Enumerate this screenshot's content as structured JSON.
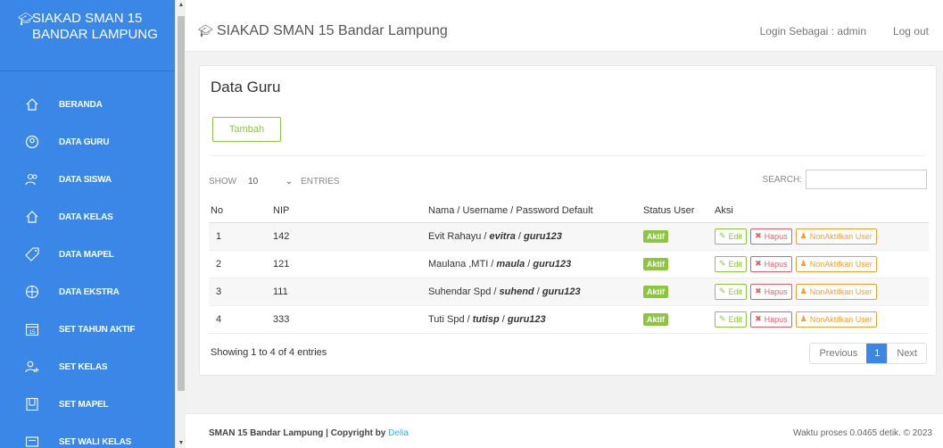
{
  "sidebar": {
    "brand_line1": "SIAKAD SMAN 15",
    "brand_line2": "BANDAR LAMPUNG",
    "brand_icon": "graduation-cap-icon",
    "items": [
      {
        "label": "BERANDA",
        "icon": "home-icon"
      },
      {
        "label": "DATA GURU",
        "icon": "user-circle-icon"
      },
      {
        "label": "DATA SISWA",
        "icon": "users-icon"
      },
      {
        "label": "DATA KELAS",
        "icon": "home-icon"
      },
      {
        "label": "DATA MAPEL",
        "icon": "tag-icon"
      },
      {
        "label": "DATA EKSTRA",
        "icon": "compass-icon"
      },
      {
        "label": "SET TAHUN AKTIF",
        "icon": "calendar-icon"
      },
      {
        "label": "SET KELAS",
        "icon": "user-plus-icon"
      },
      {
        "label": "SET MAPEL",
        "icon": "book-icon"
      },
      {
        "label": "SET WALI KELAS",
        "icon": "id-card-icon"
      }
    ],
    "calendar_number": "15"
  },
  "topbar": {
    "title": "SIAKAD SMAN 15 Bandar Lampung",
    "login_as": "Login Sebagai : admin",
    "logout": "Log out"
  },
  "main": {
    "heading": "Data Guru",
    "add_button": "Tambah",
    "show_label": "SHOW",
    "show_value": "10",
    "entries_label": "ENTRIES",
    "search_label": "SEARCH:",
    "columns": [
      "No",
      "NIP",
      "Nama / Username / Password Default",
      "Status User",
      "Aksi"
    ],
    "rows": [
      {
        "no": "1",
        "nip": "142",
        "name": "Evit Rahayu",
        "username": "evitra",
        "password": "guru123",
        "status": "Aktif"
      },
      {
        "no": "2",
        "nip": "121",
        "name": "Maulana ,MTI",
        "username": "maula",
        "password": "guru123",
        "status": "Aktif"
      },
      {
        "no": "3",
        "nip": "111",
        "name": "Suhendar Spd",
        "username": "suhend",
        "password": "guru123",
        "status": "Aktif"
      },
      {
        "no": "4",
        "nip": "333",
        "name": "Tuti Spd",
        "username": "tutisp",
        "password": "guru123",
        "status": "Aktif"
      }
    ],
    "actions": {
      "edit": "Edit",
      "delete": "Hapus",
      "deactivate": "NonAktifkan User"
    },
    "info": "Showing 1 to 4 of 4 entries",
    "pager": {
      "previous": "Previous",
      "current": "1",
      "next": "Next"
    }
  },
  "footer": {
    "left": "SMAN 15 Bandar Lampung | Copyright by ",
    "author": "Delia",
    "right": "Waktu proses 0.0465 detik. © 2023"
  }
}
